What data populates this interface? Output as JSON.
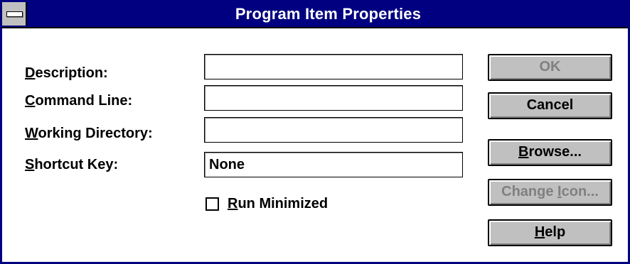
{
  "window": {
    "title": "Program Item Properties"
  },
  "fields": {
    "description": {
      "label_mnemonic": "D",
      "label_rest": "escription:",
      "value": ""
    },
    "command_line": {
      "label_mnemonic": "C",
      "label_rest": "ommand Line:",
      "value": ""
    },
    "working_directory": {
      "label_mnemonic": "W",
      "label_rest": "orking Directory:",
      "value": ""
    },
    "shortcut_key": {
      "label_mnemonic": "S",
      "label_rest": "hortcut Key:",
      "value": "None"
    }
  },
  "run_minimized": {
    "mnemonic": "R",
    "rest": "un Minimized",
    "checked": false
  },
  "buttons": {
    "ok": {
      "label": "OK",
      "enabled": false
    },
    "cancel": {
      "label": "Cancel",
      "enabled": true
    },
    "browse": {
      "mnemonic": "B",
      "rest": "rowse...",
      "enabled": true
    },
    "change_icon": {
      "pre": "Change ",
      "mnemonic": "I",
      "rest": "con...",
      "enabled": false
    },
    "help": {
      "mnemonic": "H",
      "rest": "elp",
      "enabled": true
    }
  },
  "colors": {
    "titlebar": "#000080",
    "button_face": "#c0c0c0",
    "disabled_text": "#808080"
  }
}
